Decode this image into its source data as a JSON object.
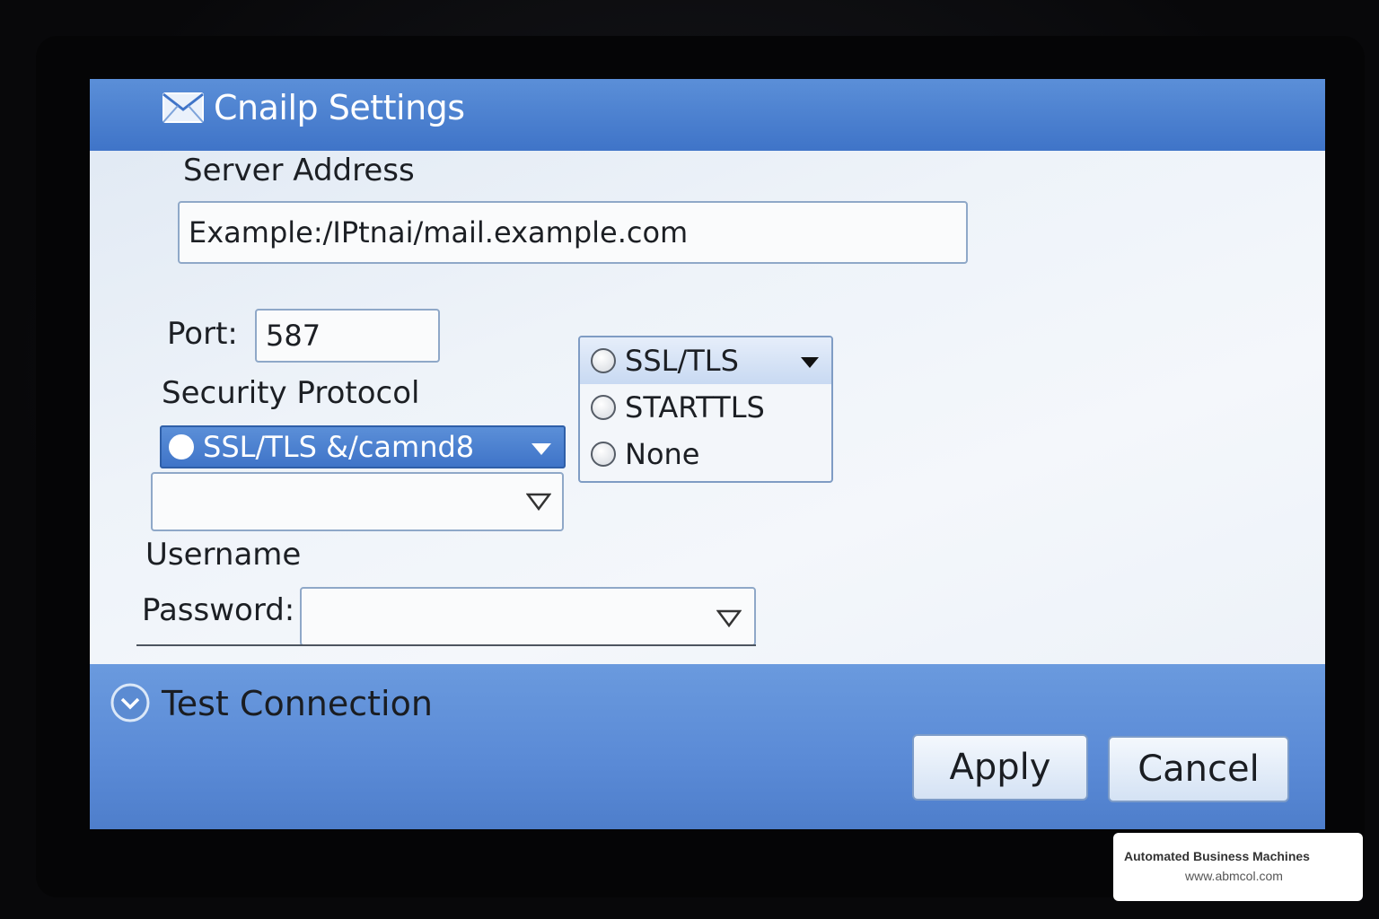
{
  "window": {
    "title": "Cnailp Settings",
    "icon": "envelope-icon"
  },
  "server": {
    "label": "Server Address",
    "value": "Example:/IPtnai/mail.example.com"
  },
  "port": {
    "label": "Port:",
    "value": "587"
  },
  "security": {
    "label": "Security Protocol",
    "selected": "SSL/TLS &/camnd8",
    "options": [
      "SSL/TLS",
      "STARTTLS",
      "None"
    ]
  },
  "username": {
    "label": "Username"
  },
  "password": {
    "label": "Password:"
  },
  "footer": {
    "test_label": "Test Connection",
    "apply_label": "Apply",
    "cancel_label": "Cancel"
  },
  "watermark": {
    "company": "Automated Business Machines",
    "url": "www.abmcol.com"
  },
  "colors": {
    "title_bar": "#3f74c8",
    "selection": "#4a7fcf",
    "screen_bg": "#eef3f9"
  }
}
